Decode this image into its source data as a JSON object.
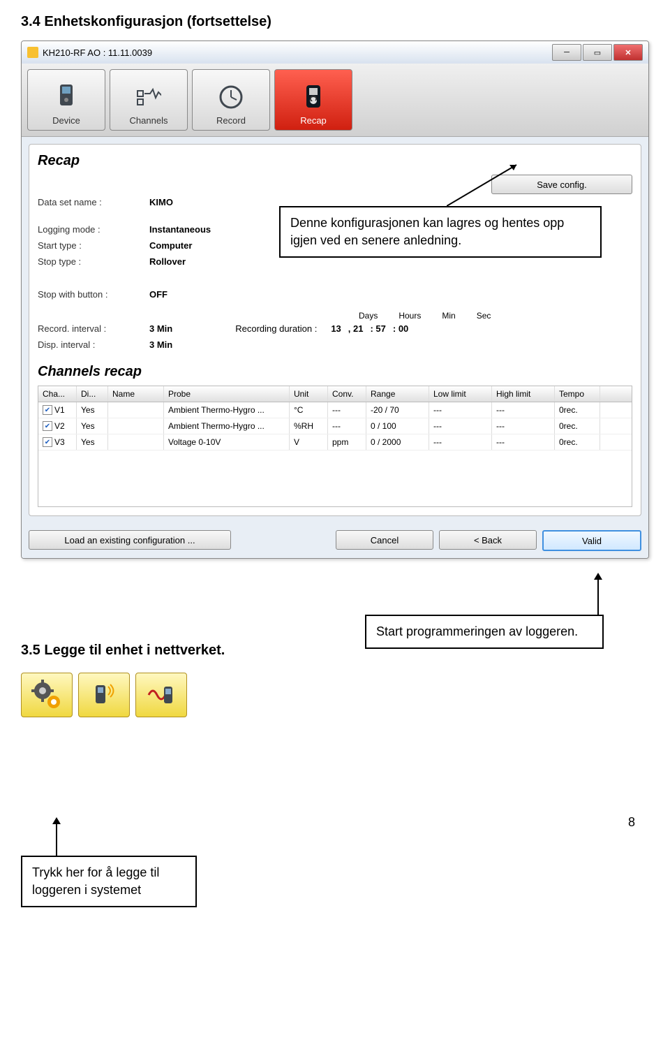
{
  "heading1": "3.4 Enhetskonfigurasjon (fortsettelse)",
  "window": {
    "title": "KH210-RF AO : 11.11.0039",
    "toolbar": [
      {
        "label": "Device"
      },
      {
        "label": "Channels"
      },
      {
        "label": "Record"
      },
      {
        "label": "Recap"
      }
    ]
  },
  "recap": {
    "title": "Recap",
    "save_btn": "Save config.",
    "rows": [
      {
        "label": "Data set name :",
        "value": "KIMO"
      },
      {
        "label": "Logging mode :",
        "value": "Instantaneous"
      },
      {
        "label": "Start type :",
        "value": "Computer"
      },
      {
        "label": "Stop type :",
        "value": "Rollover"
      },
      {
        "label": "Stop with button :",
        "value": "OFF"
      },
      {
        "label": "Record. interval :",
        "value": "3 Min"
      },
      {
        "label": "Disp. interval :",
        "value": "3 Min"
      }
    ],
    "duration": {
      "label": "Recording duration :",
      "headers": [
        "Days",
        "Hours",
        "Min",
        "Sec"
      ],
      "values": [
        "13",
        ",   21",
        ":   57",
        ":   00"
      ]
    },
    "channels_title": "Channels recap",
    "headers": [
      "Cha...",
      "Di...",
      "Name",
      "Probe",
      "Unit",
      "Conv.",
      "Range",
      "Low limit",
      "High limit",
      "Tempo"
    ],
    "data": [
      {
        "ch": "V1",
        "di": "Yes",
        "name": "",
        "probe": "Ambient Thermo-Hygro ...",
        "unit": "°C",
        "conv": "---",
        "range": "-20 / 70",
        "low": "---",
        "high": "---",
        "tempo": "0rec."
      },
      {
        "ch": "V2",
        "di": "Yes",
        "name": "",
        "probe": "Ambient Thermo-Hygro ...",
        "unit": "%RH",
        "conv": "---",
        "range": "0 / 100",
        "low": "---",
        "high": "---",
        "tempo": "0rec."
      },
      {
        "ch": "V3",
        "di": "Yes",
        "name": "",
        "probe": "Voltage 0-10V",
        "unit": "V",
        "conv": "ppm",
        "range": "0 / 2000",
        "low": "---",
        "high": "---",
        "tempo": "0rec."
      }
    ]
  },
  "dialog_btns": {
    "load": "Load an existing configuration ...",
    "cancel": "Cancel",
    "back": "< Back",
    "valid": "Valid"
  },
  "callout1": "Denne konfigurasjonen kan lagres og hentes opp igjen ved en senere anledning.",
  "callout2": "Start programmeringen av loggeren.",
  "heading2": "3.5 Legge til enhet i nettverket.",
  "callout3": "Trykk her for å legge til loggeren i systemet",
  "page_num": "8"
}
